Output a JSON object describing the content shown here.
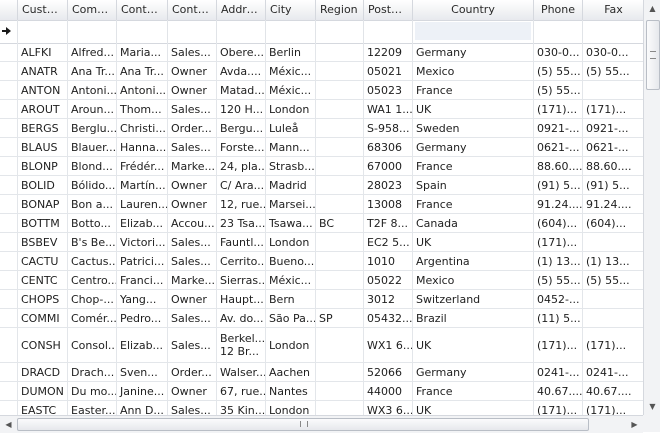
{
  "columns": [
    {
      "key": "indicator",
      "label": ""
    },
    {
      "key": "customer_id",
      "label": "Custo..."
    },
    {
      "key": "company",
      "label": "Compa..."
    },
    {
      "key": "contact_name",
      "label": "Contac..."
    },
    {
      "key": "contact_title",
      "label": "Contac..."
    },
    {
      "key": "address",
      "label": "Address"
    },
    {
      "key": "city",
      "label": "City"
    },
    {
      "key": "region",
      "label": "Region"
    },
    {
      "key": "postal",
      "label": "Postal..."
    },
    {
      "key": "country",
      "label": "Country"
    },
    {
      "key": "phone",
      "label": "Phone"
    },
    {
      "key": "fax",
      "label": "Fax"
    }
  ],
  "rows": [
    [
      "ALFKI",
      "Alfred...",
      "Maria...",
      "Sales...",
      "Obere...",
      "Berlin",
      "",
      "12209",
      "Germany",
      "030-0...",
      "030-0..."
    ],
    [
      "ANATR",
      "Ana Tr...",
      "Ana Tr...",
      "Owner",
      "Avda....",
      "Méxic...",
      "",
      "05021",
      "Mexico",
      "(5) 55...",
      "(5) 55..."
    ],
    [
      "ANTON",
      "Antoni...",
      "Antoni...",
      "Owner",
      "Matad...",
      "Méxic...",
      "",
      "05023",
      "France",
      "(5) 55...",
      ""
    ],
    [
      "AROUT",
      "Aroun...",
      "Thom...",
      "Sales...",
      "120 H...",
      "London",
      "",
      "WA1 1...",
      "UK",
      "(171)...",
      "(171)..."
    ],
    [
      "BERGS",
      "Berglu...",
      "Christi...",
      "Order...",
      "Bergu...",
      "Luleå",
      "",
      "S-958...",
      "Sweden",
      "0921-...",
      "0921-..."
    ],
    [
      "BLAUS",
      "Blauer...",
      "Hanna...",
      "Sales...",
      "Forste...",
      "Mann...",
      "",
      "68306",
      "Germany",
      "0621-...",
      "0621-..."
    ],
    [
      "BLONP",
      "Blond...",
      "Frédér...",
      "Marke...",
      "24, pla...",
      "Strasb...",
      "",
      "67000",
      "France",
      "88.60....",
      "88.60...."
    ],
    [
      "BOLID",
      "Bólido...",
      "Martín...",
      "Owner",
      "C/ Ara...",
      "Madrid",
      "",
      "28023",
      "Spain",
      "(91) 5...",
      "(91) 5..."
    ],
    [
      "BONAP",
      "Bon a...",
      "Lauren...",
      "Owner",
      "12, rue...",
      "Marsei...",
      "",
      "13008",
      "France",
      "91.24....",
      "91.24...."
    ],
    [
      "BOTTM",
      "Botto...",
      "Elizab...",
      "Accou...",
      "23 Tsa...",
      "Tsawa...",
      "BC",
      "T2F 8...",
      "Canada",
      "(604)...",
      "(604)..."
    ],
    [
      "BSBEV",
      "B's Be...",
      "Victori...",
      "Sales...",
      "Fauntl...",
      "London",
      "",
      "EC2 5...",
      "UK",
      "(171)...",
      ""
    ],
    [
      "CACTU",
      "Cactus...",
      "Patrici...",
      "Sales...",
      "Cerrito...",
      "Bueno...",
      "",
      "1010",
      "Argentina",
      "(1) 13...",
      "(1) 13..."
    ],
    [
      "CENTC",
      "Centro...",
      "Franci...",
      "Marke...",
      "Sierras...",
      "Méxic...",
      "",
      "05022",
      "Mexico",
      "(5) 55...",
      "(5) 55..."
    ],
    [
      "CHOPS",
      "Chop-...",
      "Yang...",
      "Owner",
      "Haupt...",
      "Bern",
      "",
      "3012",
      "Switzerland",
      "0452-...",
      ""
    ],
    [
      "COMMI",
      "Comér...",
      "Pedro...",
      "Sales...",
      "Av. do...",
      "São Pa...",
      "SP",
      "05432...",
      "Brazil",
      "(11) 5...",
      ""
    ],
    [
      "CONSH",
      "Consol...",
      "Elizab...",
      "Sales...",
      "Berkel... 12  Br...",
      "London",
      "",
      "WX1 6...",
      "UK",
      "(171)...",
      "(171)..."
    ],
    [
      "DRACD",
      "Drach...",
      "Sven...",
      "Order...",
      "Walser...",
      "Aachen",
      "",
      "52066",
      "Germany",
      "0241-...",
      "0241-..."
    ],
    [
      "DUMON",
      "Du mo...",
      "Janine...",
      "Owner",
      "67, rue...",
      "Nantes",
      "",
      "44000",
      "France",
      "40.67....",
      "40.67...."
    ],
    [
      "EASTC",
      "Easter...",
      "Ann D...",
      "Sales...",
      "35 Kin...",
      "London",
      "",
      "WX3 6...",
      "UK",
      "(171)...",
      "(171)..."
    ]
  ]
}
